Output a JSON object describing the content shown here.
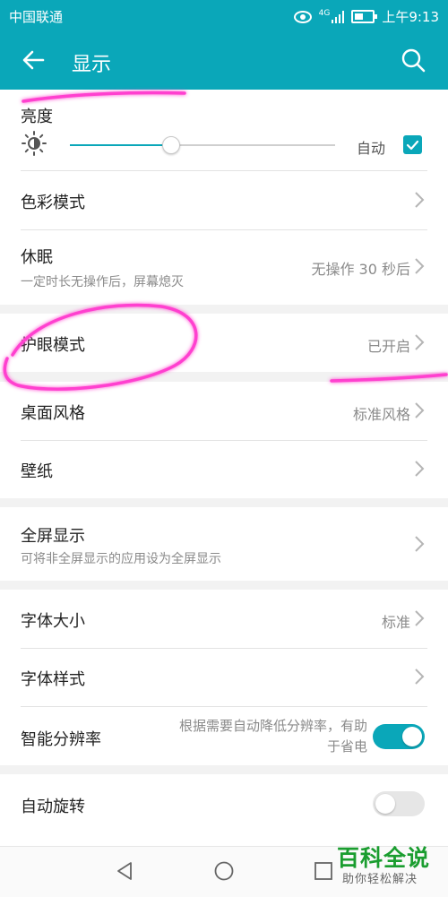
{
  "status_bar": {
    "carrier": "中国联通",
    "network": "4G",
    "time": "上午9:13"
  },
  "app_bar": {
    "title": "显示"
  },
  "brightness": {
    "label": "亮度",
    "auto_label": "自动",
    "auto_checked": true,
    "level": 0.38
  },
  "items": {
    "color_mode": {
      "label": "色彩模式"
    },
    "sleep": {
      "label": "休眠",
      "subtitle": "一定时长无操作后，屏幕熄灭",
      "value": "无操作 30 秒后"
    },
    "eye_comfort": {
      "label": "护眼模式",
      "value": "已开启"
    },
    "desktop_style": {
      "label": "桌面风格",
      "value": "标准风格"
    },
    "wallpaper": {
      "label": "壁纸"
    },
    "full_screen": {
      "label": "全屏显示",
      "subtitle": "可将非全屏显示的应用设为全屏显示"
    },
    "font_size": {
      "label": "字体大小",
      "value": "标准"
    },
    "font_style": {
      "label": "字体样式"
    },
    "smart_resolution": {
      "label": "智能分辨率",
      "description_line1": "根据需要自动降低分辨率，有助",
      "description_line2": "于省电",
      "enabled": true
    },
    "auto_rotate": {
      "label": "自动旋转",
      "enabled": false
    }
  },
  "watermark": {
    "title": "百科全说",
    "subtitle": "助你轻松解决"
  },
  "colors": {
    "accent": "#0aa7b9",
    "annotation": "#ff3fcf",
    "watermark": "#1a9d2f"
  },
  "icons": [
    "back-arrow-icon",
    "search-icon",
    "brightness-icon",
    "chevron-right-icon",
    "nav-back-icon",
    "nav-home-icon",
    "nav-recent-icon"
  ]
}
